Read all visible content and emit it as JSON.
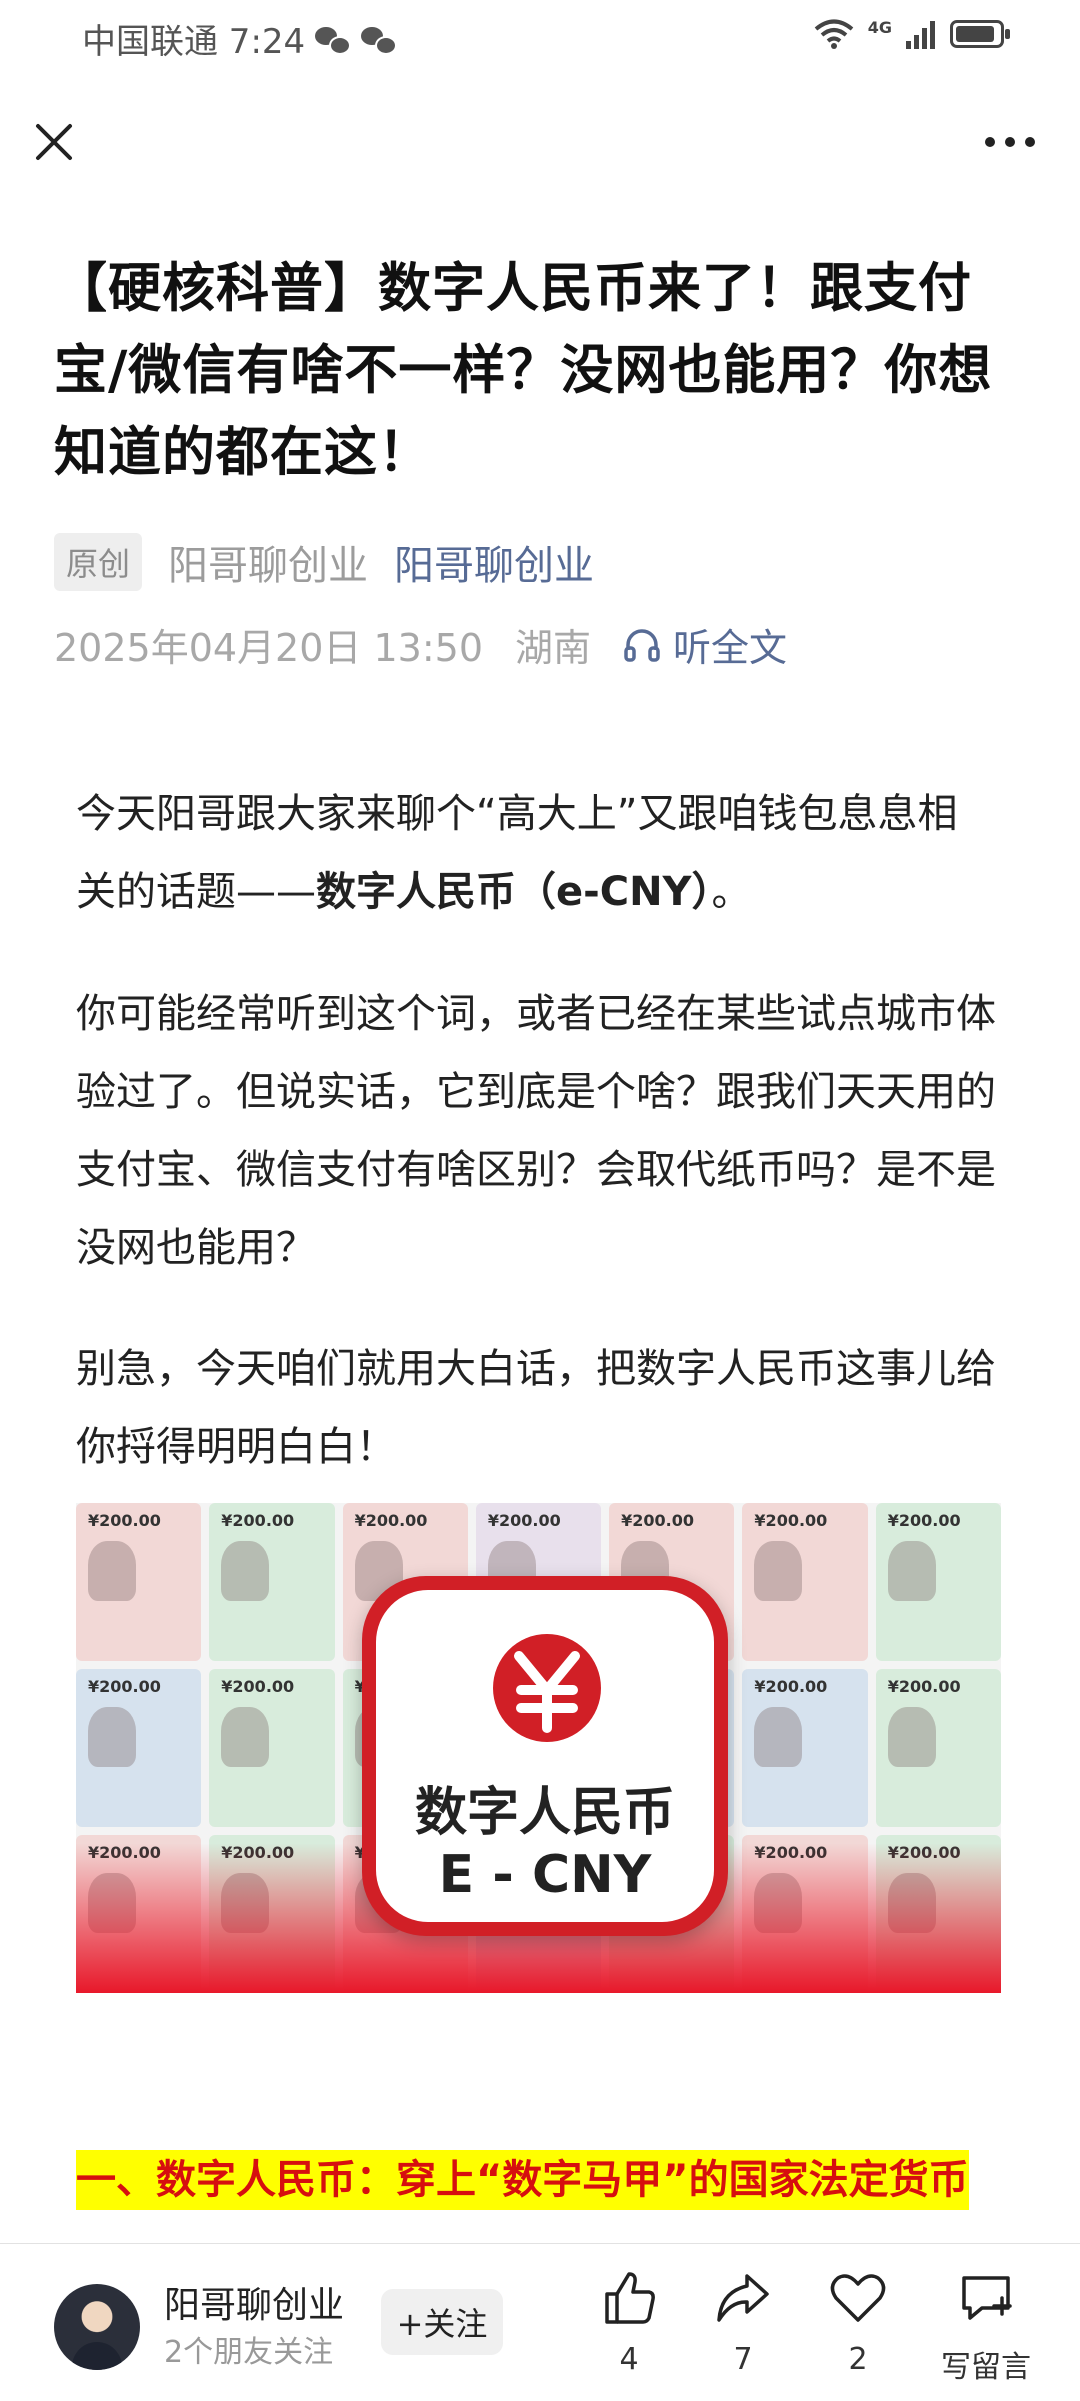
{
  "status_bar": {
    "carrier_time": "中国联通 7:24",
    "network": "4G"
  },
  "article": {
    "title": "【硬核科普】数字人民币来了！跟支付宝/微信有啥不一样？没网也能用？你想知道的都在这！",
    "badge": "原创",
    "author_plain": "阳哥聊创业",
    "author_link": "阳哥聊创业",
    "datetime": "2025年04月20日 13:50",
    "location": "湖南",
    "listen_label": "听全文",
    "p1_a": "今天阳哥跟大家来聊个“高大上”又跟咱钱包息息相关的话题——",
    "p1_b": "数字人民币（e-CNY）",
    "p1_c": "。",
    "p2": "你可能经常听到这个词，或者已经在某些试点城市体验过了。但说实话，它到底是个啥？跟我们天天用的支付宝、微信支付有啥区别？会取代纸币吗？是不是没网也能用？",
    "p3": "别急，今天咱们就用大白话，把数字人民币这事儿给你捋得明明白白！",
    "image": {
      "logo_text_cn": "数字人民币",
      "logo_text_en": "E - CNY",
      "note_value": "¥200.00"
    },
    "section_heading": "一、数字人民币：穿上“数字马甲”的国家法定货币"
  },
  "bottom_bar": {
    "account_name": "阳哥聊创业",
    "account_sub": "2个朋友关注",
    "follow_label": "+关注",
    "like_count": "4",
    "share_count": "7",
    "fav_count": "2",
    "comment_label": "写留言"
  }
}
